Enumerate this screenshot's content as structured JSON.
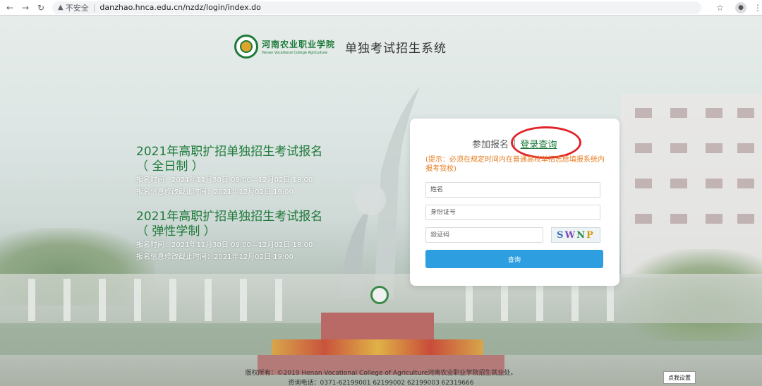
{
  "browser": {
    "security_label": "不安全",
    "url": "danzhao.hnca.edu.cn/nzdz/login/index.do",
    "icons": [
      "back-arrow-icon",
      "forward-arrow-icon",
      "reload-icon",
      "warning-icon",
      "star-icon",
      "profile-icon",
      "menu-icon"
    ]
  },
  "header": {
    "logo_cn": "河南农业职业学院",
    "logo_en": "Henan Vocational College Agriculture",
    "system_title": "单独考试招生系统"
  },
  "notices": [
    {
      "title_line1": "2021年高职扩招单独招生考试报名",
      "title_line2": "（ 全日制 ）",
      "reg_time": "报名时间：2021年11月30日 09:00—12月02日 18:00",
      "edit_deadline": "报名信息修改截止时间：2021年12月02日 19:00"
    },
    {
      "title_line1": "2021年高职扩招单独招生考试报名",
      "title_line2": "（ 弹性学制 ）",
      "reg_time": "报名时间：2021年11月30日 09:00—12月02日 18:00",
      "edit_deadline": "报名信息修改截止时间：2021年12月02日 19:00"
    }
  ],
  "login_card": {
    "tab_register": "参加报名",
    "tab_separator": "|",
    "tab_query": "登录查询",
    "tip": "(提示：必须在规定时间内在普通高校单招志愿填报系统内报考我校)",
    "name_placeholder": "姓名",
    "id_placeholder": "身份证号",
    "captcha_placeholder": "验证码",
    "captcha_chars": [
      "S",
      "W",
      "N",
      "P"
    ],
    "submit_label": "查询",
    "accent_color": "#2d9ee0",
    "highlight_color": "#e0262a"
  },
  "footer": {
    "copyright": "版权所有：©2019 Henan Vocational College of Agriculture河南农业职业学院招生就业处。",
    "phone": "资询电话：0371-62199001 62199002 62199003 62319666"
  },
  "settings_button": "点我设置"
}
